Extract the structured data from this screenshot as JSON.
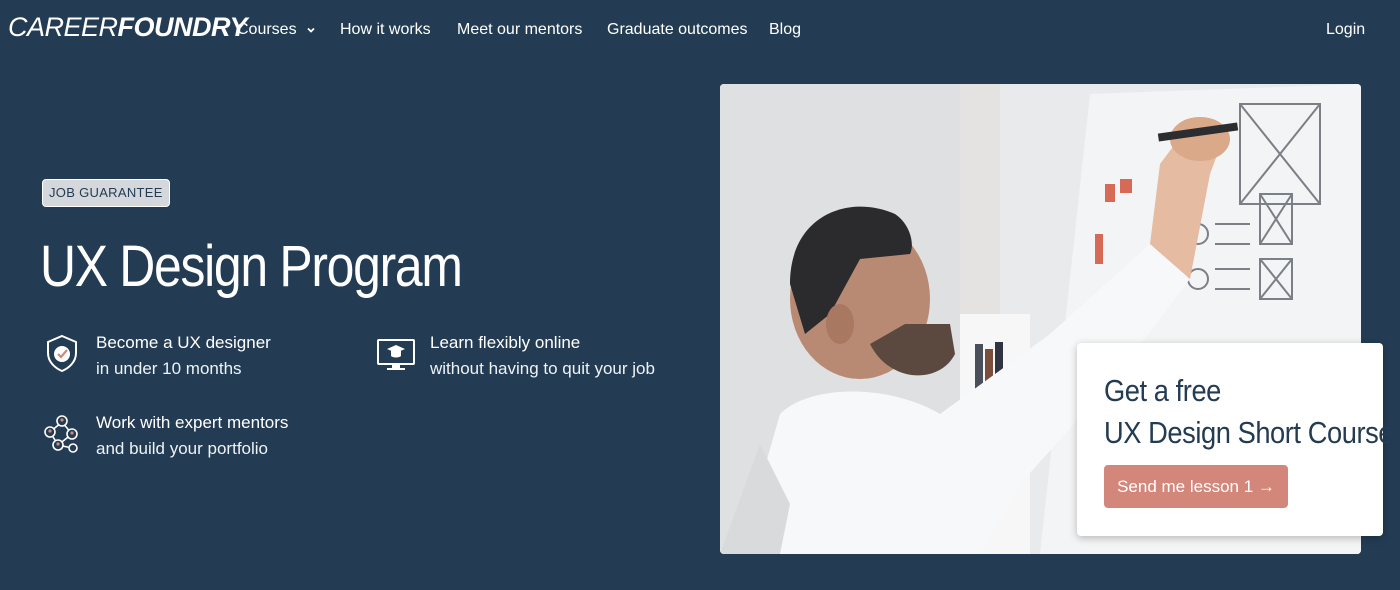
{
  "nav": {
    "logo_light": "CAREER",
    "logo_bold": "FOUNDRY",
    "links": [
      "Courses",
      "How it works",
      "Meet our mentors",
      "Graduate outcomes",
      "Blog"
    ],
    "login": "Login"
  },
  "hero": {
    "badge": "JOB GUARANTEE",
    "title": "UX Design Program",
    "features": [
      {
        "icon": "shield-check-icon",
        "line1": "Become a UX designer",
        "line2": "in under 10 months"
      },
      {
        "icon": "monitor-graduation-cap-icon",
        "line1": "Learn flexibly online",
        "line2": "without having to quit your job"
      },
      {
        "icon": "mentors-network-icon",
        "line1": "Work with expert mentors",
        "line2": "and build your portfolio"
      }
    ]
  },
  "promo": {
    "heading_line1": "Get a free",
    "heading_line2": "UX Design Short Course",
    "cta": "Send me lesson 1 →"
  },
  "colors": {
    "background": "#233c53",
    "cta": "#d3877b",
    "badge": "#d4d8dc"
  }
}
